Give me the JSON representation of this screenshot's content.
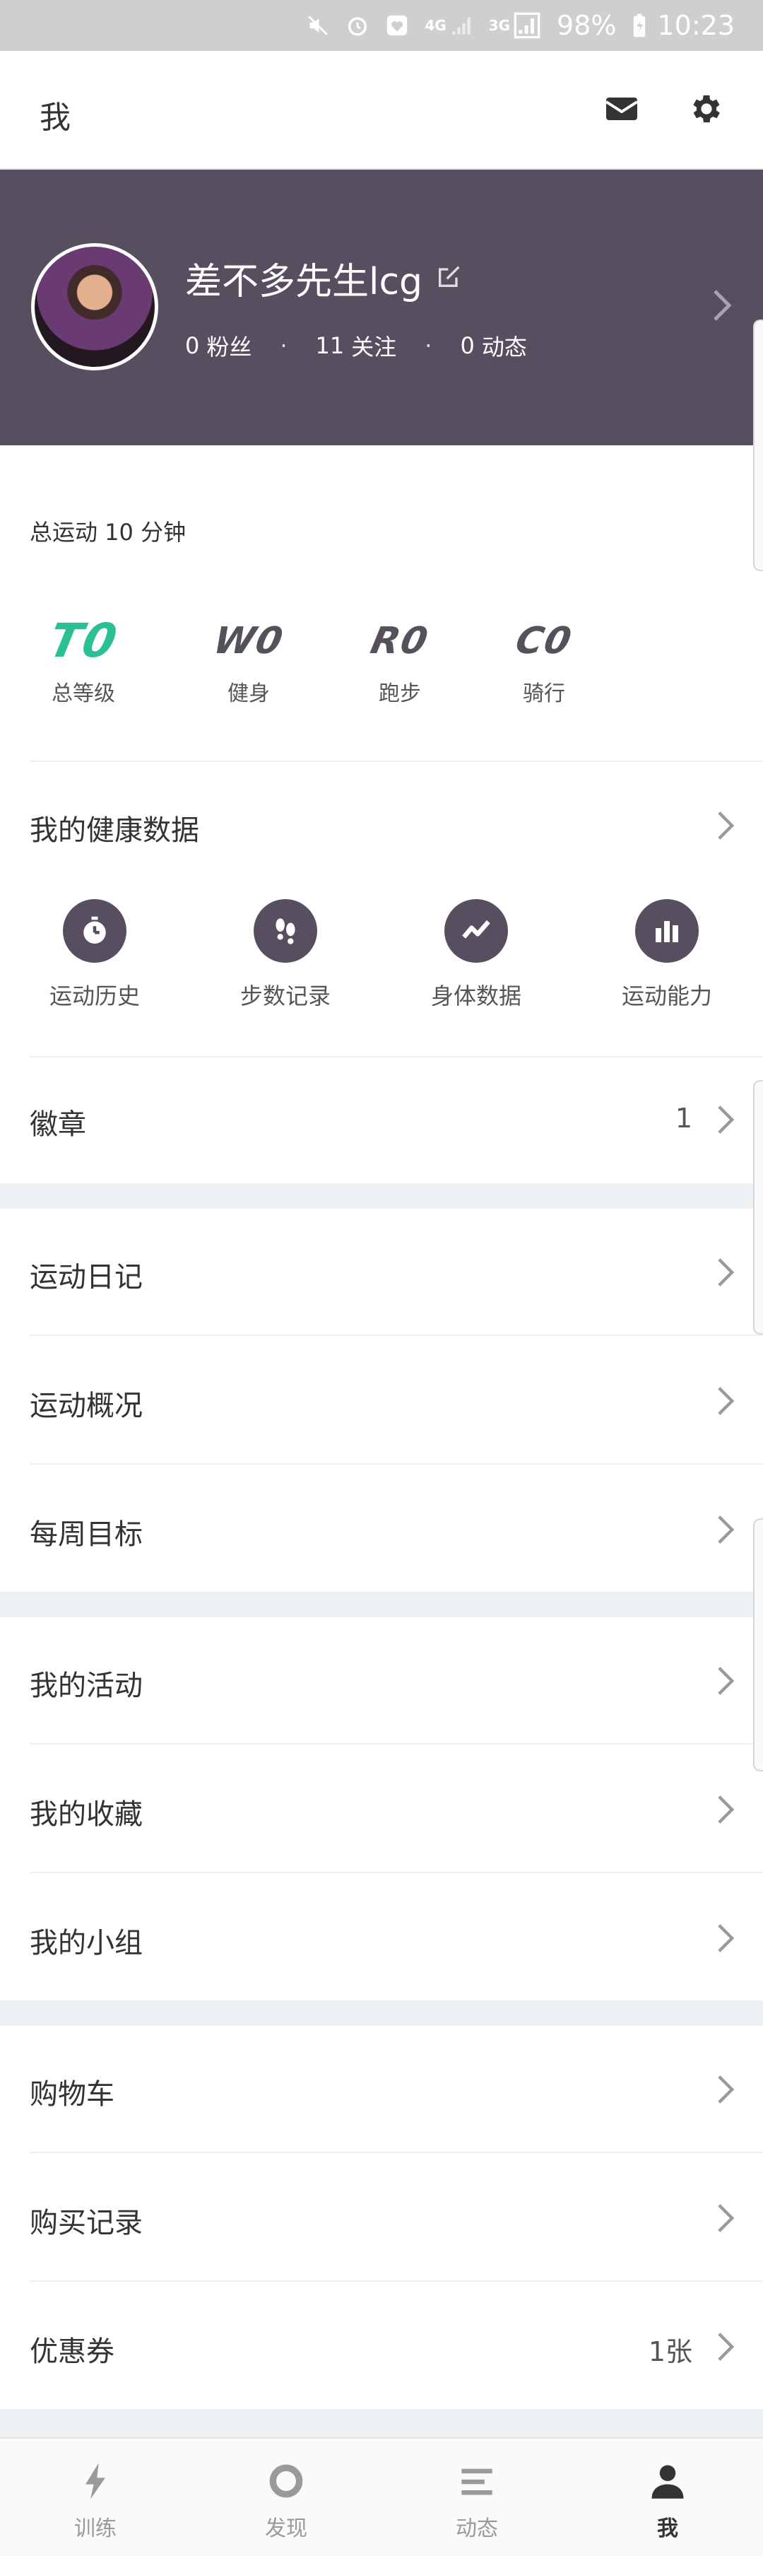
{
  "status_bar": {
    "net_4g": "4G",
    "net_3g": "3G",
    "battery": "98%",
    "time": "10:23"
  },
  "header": {
    "title": "我",
    "icons": [
      "mail-icon",
      "gear-icon"
    ]
  },
  "profile": {
    "name": "差不多先生lcg",
    "fans_count": "0",
    "fans_label": "粉丝",
    "following_count": "11",
    "following_label": "关注",
    "posts_count": "0",
    "posts_label": "动态",
    "background_color": "#574f60"
  },
  "total_exercise": "总运动 10 分钟",
  "levels": [
    {
      "code": "T0",
      "label": "总等级"
    },
    {
      "code": "W0",
      "label": "健身"
    },
    {
      "code": "R0",
      "label": "跑步"
    },
    {
      "code": "C0",
      "label": "骑行"
    }
  ],
  "level_accent": "#2bc094",
  "health": {
    "title": "我的健康数据",
    "items": [
      {
        "label": "运动历史",
        "icon": "stopwatch-icon"
      },
      {
        "label": "步数记录",
        "icon": "footprints-icon"
      },
      {
        "label": "身体数据",
        "icon": "trend-line-icon"
      },
      {
        "label": "运动能力",
        "icon": "bar-chart-icon"
      }
    ]
  },
  "badge": {
    "label": "徽章",
    "value": "1"
  },
  "group1": [
    {
      "label": "运动日记"
    },
    {
      "label": "运动概况"
    },
    {
      "label": "每周目标"
    }
  ],
  "group2": [
    {
      "label": "我的活动"
    },
    {
      "label": "我的收藏"
    },
    {
      "label": "我的小组"
    }
  ],
  "group3": [
    {
      "label": "购物车"
    },
    {
      "label": "购买记录"
    },
    {
      "label": "优惠券",
      "value": "1张"
    }
  ],
  "tabs": [
    {
      "label": "训练",
      "icon": "lightning-icon"
    },
    {
      "label": "发现",
      "icon": "discover-ring-icon"
    },
    {
      "label": "动态",
      "icon": "feed-lines-icon"
    },
    {
      "label": "我",
      "icon": "person-icon",
      "active": true
    }
  ]
}
